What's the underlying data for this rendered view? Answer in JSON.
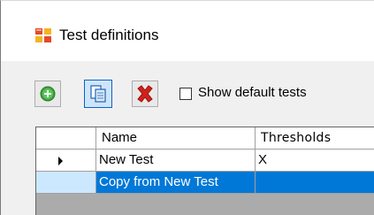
{
  "window": {
    "title": "Test definitions",
    "icon": "app-window-icon"
  },
  "toolbar": {
    "add_icon": "add-circle-icon",
    "copy_icon": "copy-icon",
    "delete_icon": "delete-x-icon",
    "show_default_label": "Show default tests",
    "show_default_checked": false
  },
  "grid": {
    "columns": [
      "Name",
      "Thresholds"
    ],
    "rows": [
      {
        "name": "New Test",
        "thresholds": "X",
        "current": true,
        "selected": false
      },
      {
        "name": "Copy from New Test",
        "thresholds": "",
        "current": false,
        "selected": true
      }
    ]
  },
  "colors": {
    "selection": "#0078d7",
    "selection_header": "#cce8ff",
    "add_green": "#3ca23c",
    "delete_red": "#d0211d"
  }
}
